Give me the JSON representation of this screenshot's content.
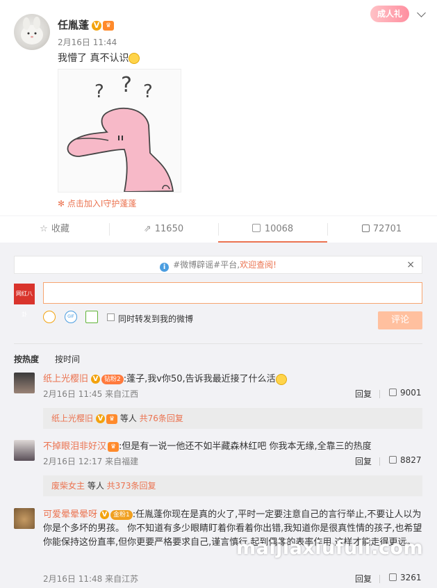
{
  "post": {
    "username": "任胤蓬",
    "vbadge": "V",
    "time": "2月16日 11:44",
    "content": "我懵了 真不认识",
    "join_text": "点击加入I守护蓬蓬",
    "gift_label": "成人礼"
  },
  "actions": [
    {
      "label": "收藏",
      "icon": "star-icon"
    },
    {
      "label": "11650",
      "icon": "forward-icon"
    },
    {
      "label": "10068",
      "icon": "comment-icon"
    },
    {
      "label": "72701",
      "icon": "like-icon"
    }
  ],
  "notice": {
    "text_prefix": "#微博辟谣#平台,",
    "link_text": "欢迎查阅!",
    "close": "×"
  },
  "composer": {
    "avatar_text": "网红八卦",
    "forward_label": "同时转发到我的微博",
    "submit_label": "评论"
  },
  "sort": {
    "hot": "按热度",
    "time": "按时间"
  },
  "comments": [
    {
      "name": "纸上光樱旧",
      "fan_label": "钻粉2",
      "text": ":蓬子,我v你50,告诉我最近接了什么活",
      "meta": "2月16日 11:45 来自江西",
      "reply": "回复",
      "likes": "9001",
      "sub": {
        "name": "纸上光樱旧",
        "middle": " 等人 ",
        "count": "共76条回复"
      }
    },
    {
      "name": "不掉眼泪非好汉",
      "fan_label": "",
      "text": ":但是有一说一他还不如半藏森林红吧 你我本无缘,全靠三的热度",
      "meta": "2月16日 12:17 来自福建",
      "reply": "回复",
      "likes": "8827",
      "sub": {
        "name": "废柴女主",
        "middle": " 等人 ",
        "count": "共373条回复"
      }
    },
    {
      "name": "可爱晕晕晕呀",
      "fan_label": "金粉1",
      "text": ":任胤蓬你现在是真的火了,平时一定要注意自己的言行举止,不要让人以为你是个多坏的男孩。 你不知道有多少眼睛盯着你看着你出错,我知道你是很真性情的孩子,也希望你能保持这份直率,但你更要严格要求自己,谨言慎行,起到偶像的表率作用,这样才能走得更远。",
      "meta": "2月16日 11:48 来自江苏",
      "reply": "回复",
      "likes": "3261"
    }
  ],
  "watermark": "maijiaxiufuli.com"
}
